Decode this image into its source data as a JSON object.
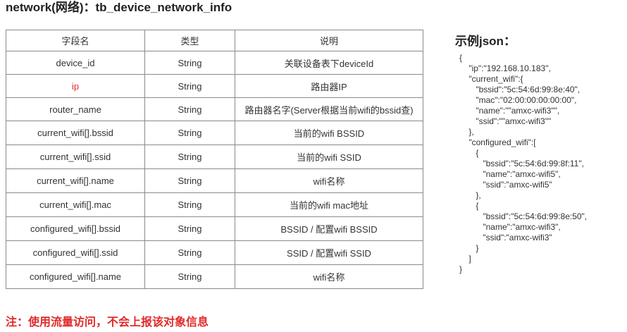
{
  "page_title": "network(网络)：tb_device_network_info",
  "table": {
    "headers": [
      "字段名",
      "类型",
      "说明"
    ],
    "rows": [
      {
        "field": "device_id",
        "type": "String",
        "desc": "关联设备表下deviceId",
        "highlight": false
      },
      {
        "field": "ip",
        "type": "String",
        "desc": "路由器IP",
        "highlight": true
      },
      {
        "field": "router_name",
        "type": "String",
        "desc": "路由器名字(Server根据当前wifi的bssid查)",
        "highlight": false
      },
      {
        "field": "current_wifi[].bssid",
        "type": "String",
        "desc": "当前的wifi BSSID",
        "highlight": false
      },
      {
        "field": "current_wifi[].ssid",
        "type": "String",
        "desc": "当前的wifi SSID",
        "highlight": false
      },
      {
        "field": "current_wifi[].name",
        "type": "String",
        "desc": "wifi名称",
        "highlight": false
      },
      {
        "field": "current_wifi[].mac",
        "type": "String",
        "desc": "当前的wifi mac地址",
        "highlight": false
      },
      {
        "field": "configured_wifi[].bssid",
        "type": "String",
        "desc": "BSSID / 配置wifi BSSID",
        "highlight": false
      },
      {
        "field": "configured_wifi[].ssid",
        "type": "String",
        "desc": "SSID / 配置wifi SSID",
        "highlight": false
      },
      {
        "field": "configured_wifi[].name",
        "type": "String",
        "desc": "wifi名称",
        "highlight": false
      }
    ]
  },
  "json_example": {
    "title": "示例json：",
    "lines": [
      "{",
      "    \"ip\":\"192.168.10.183\",",
      "    \"current_wifi\":{",
      "       \"bssid\":\"5c:54:6d:99:8e:40\",",
      "       \"mac\":\"02:00:00:00:00:00\",",
      "       \"name\":\"\"amxc-wifi3\"\",",
      "       \"ssid\":\"\"amxc-wifi3\"\"",
      "    },",
      "    \"configured_wifi\":[",
      "       {",
      "          \"bssid\":\"5c:54:6d:99:8f:11\",",
      "          \"name\":\"amxc-wifi5\",",
      "          \"ssid\":\"amxc-wifi5\"",
      "       },",
      "       {",
      "          \"bssid\":\"5c:54:6d:99:8e:50\",",
      "          \"name\":\"amxc-wifi3\",",
      "          \"ssid\":\"amxc-wifi3\"",
      "       }",
      "    ]",
      "}"
    ]
  },
  "note": "注：使用流量访问，不会上报该对象信息",
  "colors": {
    "highlight": "#e02b2b",
    "border": "#8a8a8a",
    "text": "#333333"
  }
}
